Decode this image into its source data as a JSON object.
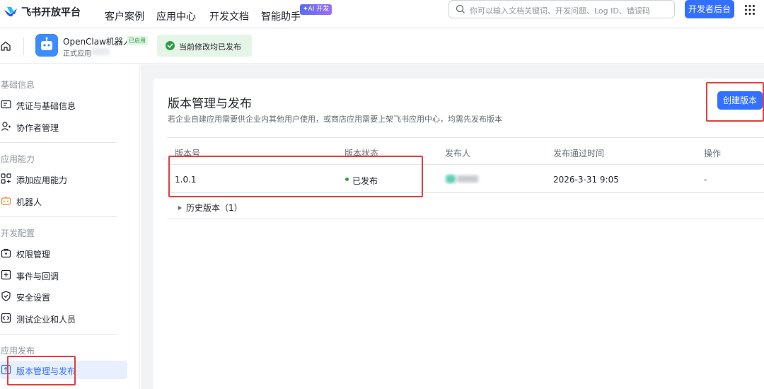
{
  "topnav": {
    "logo_text": "飞书开放平台",
    "items": [
      "客户案例",
      "应用中心",
      "开发文档",
      "智能助手"
    ],
    "ai_badge": "✦AI 开发",
    "search_placeholder": "你可以输入文档关键词、开发问题、Log ID、错误码",
    "dev_console_button": "开发者后台",
    "brand_color": "#3370ff"
  },
  "app_header": {
    "app_name": "OpenClaw机器人",
    "enabled_badge": "已启用",
    "app_type": "正式应用",
    "publish_status": "当前修改均已发布"
  },
  "sidebar": {
    "sections": [
      {
        "title": "基础信息",
        "items": [
          {
            "label": "凭证与基础信息",
            "icon": "credential-icon"
          },
          {
            "label": "协作者管理",
            "icon": "collaborator-icon"
          }
        ]
      },
      {
        "title": "应用能力",
        "items": [
          {
            "label": "添加应用能力",
            "icon": "add-capability-icon"
          },
          {
            "label": "机器人",
            "icon": "robot-icon"
          }
        ]
      },
      {
        "title": "开发配置",
        "items": [
          {
            "label": "权限管理",
            "icon": "permission-icon"
          },
          {
            "label": "事件与回调",
            "icon": "event-icon"
          },
          {
            "label": "安全设置",
            "icon": "shield-icon"
          },
          {
            "label": "测试企业和人员",
            "icon": "test-icon"
          }
        ]
      },
      {
        "title": "应用发布",
        "items": [
          {
            "label": "版本管理与发布",
            "icon": "publish-icon",
            "active": true
          }
        ]
      }
    ]
  },
  "main": {
    "title": "版本管理与发布",
    "description": "若企业自建应用需要供企业内其他用户使用，或商店应用需要上架飞书应用中心，均需先发布版本",
    "create_button": "创建版本",
    "table": {
      "headers": [
        "版本号",
        "版本状态",
        "发布人",
        "发布通过时间",
        "操作"
      ],
      "rows": [
        {
          "version": "1.0.1",
          "status": "已发布",
          "publisher": "",
          "time": "2026-3-31 9:05",
          "action": "-"
        }
      ]
    },
    "history_label": "历史版本（1）"
  }
}
